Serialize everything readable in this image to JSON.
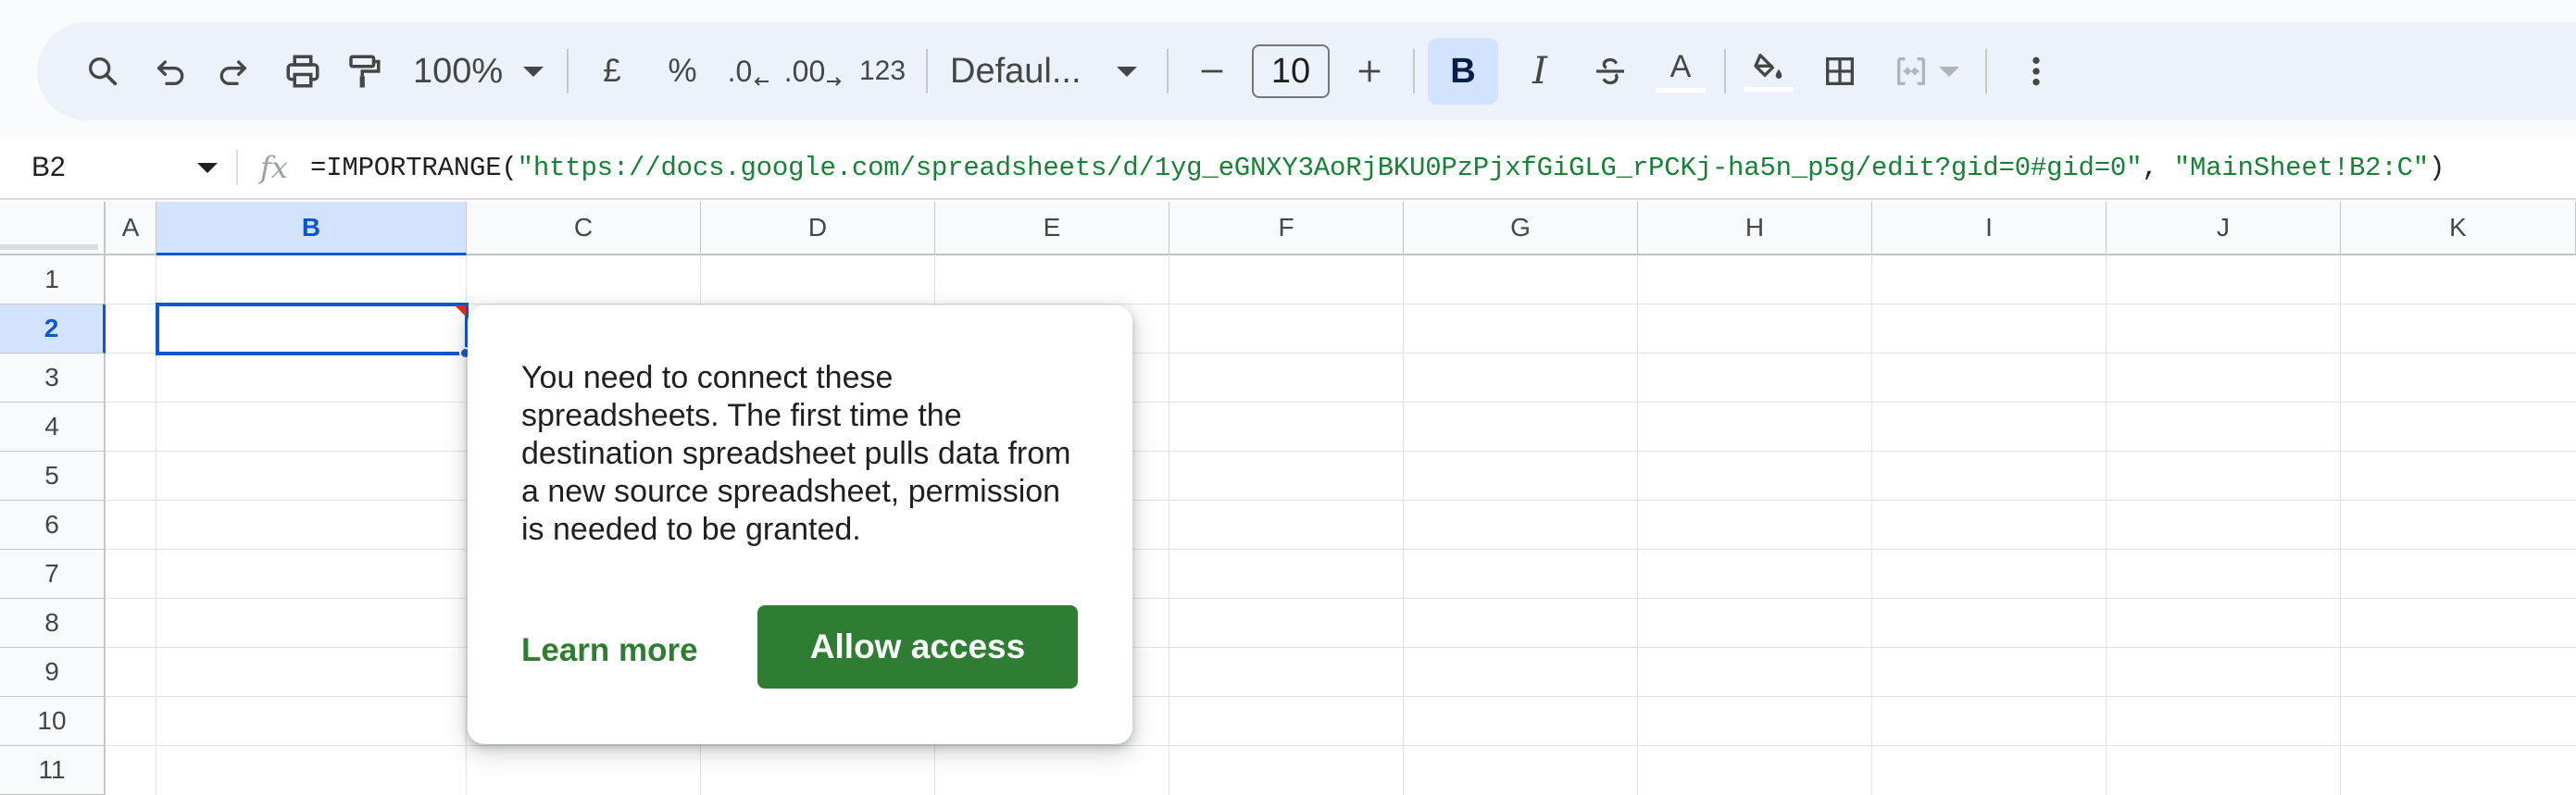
{
  "toolbar": {
    "zoom": "100%",
    "currency": "£",
    "percent": "%",
    "decrease_decimal": ".0",
    "increase_decimal": ".00",
    "more_formats": "123",
    "font": "Defaul...",
    "font_size": "10",
    "bold": "B",
    "italic": "I",
    "text_color": "A",
    "icons": [
      "search-icon",
      "undo-icon",
      "redo-icon",
      "print-icon",
      "paint-format-icon",
      "minus-icon",
      "plus-icon",
      "strikethrough-icon",
      "fill-color-icon",
      "borders-icon",
      "merge-cells-icon",
      "more-vert-icon"
    ]
  },
  "formula_bar": {
    "cell_ref": "B2",
    "fx": "fx",
    "formula_prefix": "=IMPORTRANGE(",
    "arg_url": "\"https://docs.google.com/spreadsheets/d/1yg_eGNXY3AoRjBKU0PzPjxfGiGLG_rPCKj-ha5n_p5g/edit?gid=0#gid=0\"",
    "arg_sep": ", ",
    "arg_range": "\"MainSheet!B2:C\"",
    "formula_suffix": ")"
  },
  "grid": {
    "columns": [
      "A",
      "B",
      "C",
      "D",
      "E",
      "F",
      "G",
      "H",
      "I",
      "J",
      "K"
    ],
    "rows": [
      "1",
      "2",
      "3",
      "4",
      "5",
      "6",
      "7",
      "8",
      "9",
      "10",
      "11"
    ],
    "selected_column": "B",
    "selected_row": "2"
  },
  "popup": {
    "message": "You need to connect these spreadsheets. The first time the destination spreadsheet pulls data from a new source spreadsheet, permission is needed to be granted.",
    "learn_more": "Learn more",
    "allow_access": "Allow access"
  },
  "colors": {
    "accent": "#0b57d0",
    "selection_bg": "#d3e3fd",
    "toolbar_bg": "#edf2fa",
    "button_green": "#2e7d32",
    "string_green": "#188038",
    "error_red": "#d93025"
  }
}
